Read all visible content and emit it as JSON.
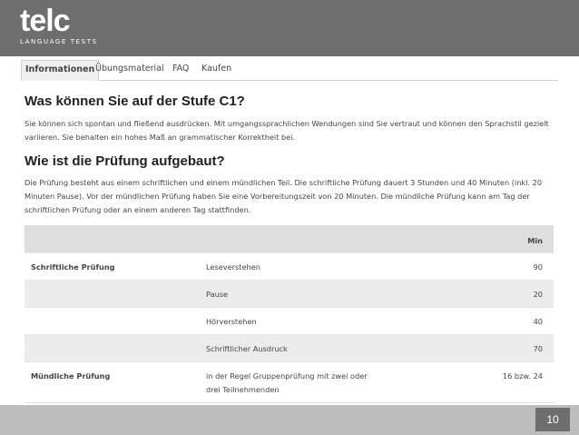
{
  "header": {
    "logo_text": "telc",
    "logo_subtitle": "LANGUAGE TESTS"
  },
  "tabs": [
    {
      "label": "Informationen",
      "active": true
    },
    {
      "label": "Übungsmaterial",
      "active": false
    },
    {
      "label": "FAQ",
      "active": false
    },
    {
      "label": "Kaufen",
      "active": false
    }
  ],
  "section1": {
    "heading": "Was können Sie auf der Stufe C1?",
    "text": "Sie können sich spontan und fließend ausdrücken. Mit umgangssprachlichen Wendungen sind Sie vertraut und können den Sprachstil gezielt variieren. Sie behalten ein hohes Maß an grammatischer Korrektheit bei."
  },
  "section2": {
    "heading": "Wie ist die Prüfung aufgebaut?",
    "text": "Die Prüfung besteht aus einem schriftlichen und einem mündlichen Teil. Die schriftliche Prüfung dauert 3 Stunden und 40 Minuten (inkl. 20 Minuten Pause). Vor der mündlichen Prüfung haben Sie eine Vorbereitungszeit von 20 Minuten. Die mündliche Prüfung kann am Tag der schriftlichen Prüfung oder an einem anderen Tag stattfinden."
  },
  "table": {
    "header_min": "Min",
    "rows": [
      {
        "part": "Schriftliche Prüfung",
        "component": "Leseverstehen",
        "min": "90"
      },
      {
        "part": "",
        "component": "Pause",
        "min": "20"
      },
      {
        "part": "",
        "component": "Hörverstehen",
        "min": "40"
      },
      {
        "part": "",
        "component": "Schriftlicher Ausdruck",
        "min": "70"
      },
      {
        "part": "Mündliche Prüfung",
        "component": "in der Regel Gruppenprüfung mit zwei oder drei Teilnehmenden",
        "min": "16 bzw. 24"
      }
    ]
  },
  "footer": {
    "page_number": "10"
  },
  "colors": {
    "topbar": "#6e6e6e",
    "footer": "#bdbdbd",
    "table_header": "#dedede",
    "row_shade": "#ececec"
  }
}
